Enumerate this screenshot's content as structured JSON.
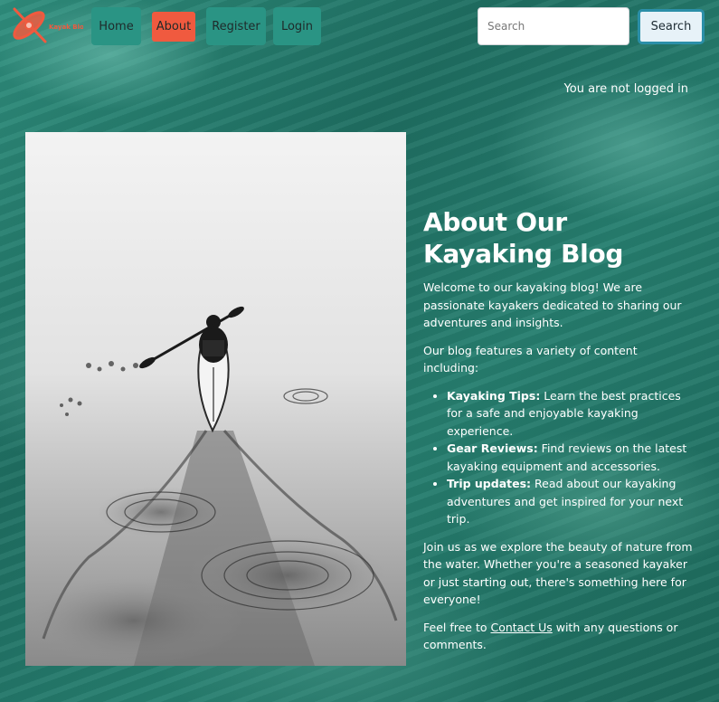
{
  "brand": {
    "logo_icon": "kayak-icon",
    "logo_text": "Kayak Blog",
    "logo_color": "#f05a3f"
  },
  "nav": {
    "items": [
      {
        "label": "Home"
      },
      {
        "label": "About"
      },
      {
        "label": "Register"
      },
      {
        "label": "Login"
      }
    ],
    "active": "About",
    "button_color": "#2a9484",
    "active_color": "#f05a3f"
  },
  "search": {
    "placeholder": "Search",
    "value": "",
    "button_label": "Search"
  },
  "login_status": "You are not logged in",
  "hero_image": {
    "alt": "Kayaker paddling across still water in black and white"
  },
  "about": {
    "title": "About Our Kayaking Blog",
    "intro": "Welcome to our kayaking blog! We are passionate kayakers dedicated to sharing our adventures and insights.",
    "features_lead": "Our blog features a variety of content including:",
    "features": [
      {
        "label": "Kayaking Tips:",
        "text": " Learn the best practices for a safe and enjoyable kayaking experience."
      },
      {
        "label": "Gear Reviews:",
        "text": " Find reviews on the latest kayaking equipment and accessories."
      },
      {
        "label": "Trip updates:",
        "text": " Read about our kayaking adventures and get inspired for your next trip."
      }
    ],
    "join": "Join us as we explore the beauty of nature from the water. Whether you're a seasoned kayaker or just starting out, there's something here for everyone!",
    "contact_prefix": "Feel free to ",
    "contact_link": "Contact Us",
    "contact_suffix": " with any questions or comments."
  }
}
